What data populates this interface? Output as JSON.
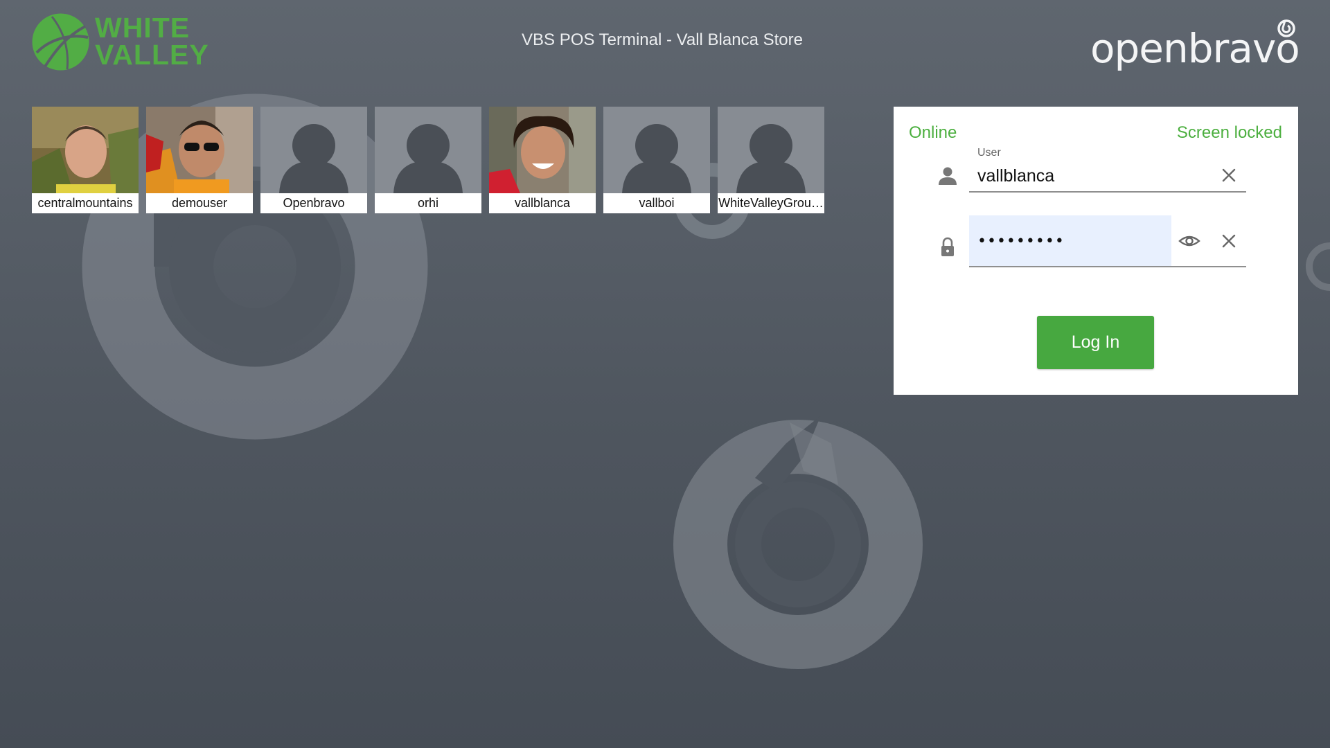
{
  "header": {
    "brand_line1": "WHITE",
    "brand_line2": "VALLEY",
    "terminal_title": "VBS POS Terminal - Vall Blanca Store",
    "vendor_logo": "openbravo"
  },
  "users": [
    {
      "name": "centralmountains",
      "avatar": "photo"
    },
    {
      "name": "demouser",
      "avatar": "photo"
    },
    {
      "name": "Openbravo",
      "avatar": "placeholder"
    },
    {
      "name": "orhi",
      "avatar": "placeholder"
    },
    {
      "name": "vallblanca",
      "avatar": "photo"
    },
    {
      "name": "vallboi",
      "avatar": "placeholder"
    },
    {
      "name": "WhiteValleyGrou…",
      "avatar": "placeholder"
    }
  ],
  "login": {
    "status_connection": "Online",
    "status_lock": "Screen locked",
    "user_label": "User",
    "user_value": "vallblanca",
    "password_value": "•••••••••",
    "login_button": "Log In"
  },
  "icons": {
    "user": "person-icon",
    "password": "lock-icon",
    "show_password": "eye-icon",
    "clear": "close-icon"
  },
  "colors": {
    "accent": "#4caf3f",
    "button": "#47a840",
    "background": "#555c65",
    "autofill": "#e8f0fe"
  }
}
